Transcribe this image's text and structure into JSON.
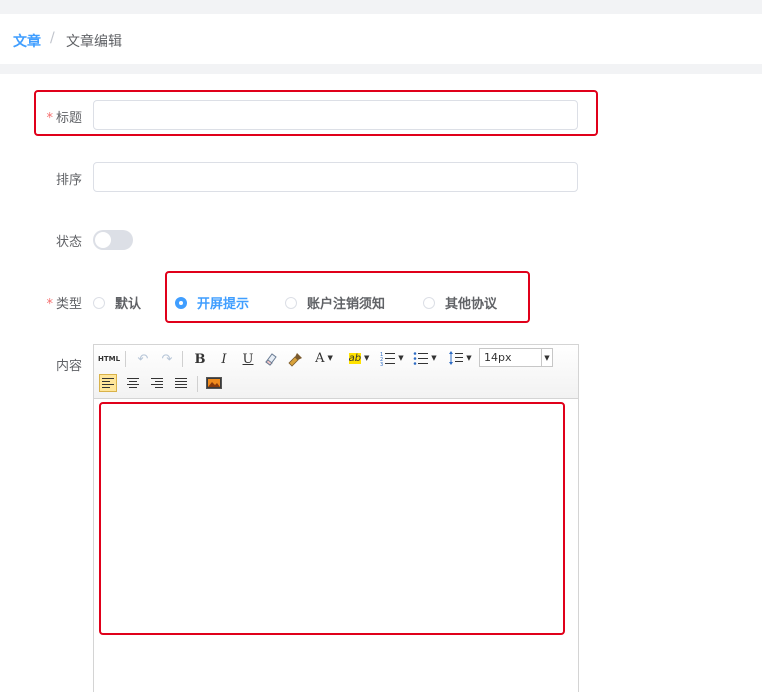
{
  "breadcrumb": {
    "home": "文章",
    "separator": "/",
    "current": "文章编辑"
  },
  "form": {
    "title": {
      "label": "标题",
      "required_mark": "*",
      "value": ""
    },
    "sort": {
      "label": "排序",
      "value": ""
    },
    "status": {
      "label": "状态",
      "enabled": false
    },
    "type": {
      "label": "类型",
      "required_mark": "*",
      "options": [
        "默认",
        "开屏提示",
        "账户注销须知",
        "其他协议"
      ],
      "selected": "开屏提示"
    },
    "content": {
      "label": "内容",
      "value": ""
    }
  },
  "editor_toolbar": {
    "html": "HTML",
    "bold": "B",
    "italic": "I",
    "underline": "U",
    "font_color": "A",
    "highlight": "ab",
    "font_size": "14px"
  },
  "colors": {
    "accent": "#409eff",
    "required": "#f56c6c",
    "highlight_box": "#e0001a"
  }
}
